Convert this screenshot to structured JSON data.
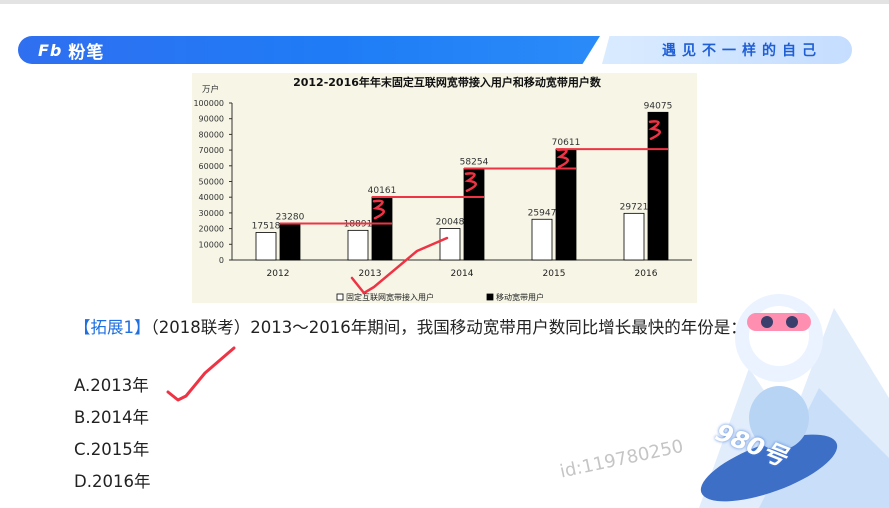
{
  "brand": {
    "logo_mark": "Fb",
    "logo_text": "粉笔"
  },
  "banner": {
    "slogan": "遇见不一样的自己"
  },
  "chart_data": {
    "type": "bar",
    "title": "2012-2016年年末固定互联网宽带接入用户和移动宽带用户数",
    "ylabel": "万户",
    "ylim": [
      0,
      100000
    ],
    "yticks": [
      0,
      10000,
      20000,
      30000,
      40000,
      50000,
      60000,
      70000,
      80000,
      90000,
      100000
    ],
    "categories": [
      "2012",
      "2013",
      "2014",
      "2015",
      "2016"
    ],
    "series": [
      {
        "name": "固定互联网宽带接入用户",
        "values": [
          17518,
          18891,
          20048,
          25947,
          29721
        ],
        "color": "#ffffff"
      },
      {
        "name": "移动宽带用户",
        "values": [
          23280,
          40161,
          58254,
          70611,
          94075
        ],
        "color": "#000000"
      }
    ],
    "value_labels": [
      [
        "17518",
        "18891",
        "20048",
        "25947",
        "29721"
      ],
      [
        "23280",
        "40161",
        "58254",
        "70611",
        "94075"
      ]
    ],
    "legend_position": "bottom"
  },
  "question": {
    "tag": "【拓展1】",
    "text": "（2018联考）2013～2016年期间，我国移动宽带用户数同比增长最快的年份是："
  },
  "options": [
    {
      "label": "A.2013年"
    },
    {
      "label": "B.2014年"
    },
    {
      "label": "C.2015年"
    },
    {
      "label": "D.2016年"
    }
  ],
  "watermark": "id:119780250",
  "mascot_tag": "980号",
  "colors": {
    "brand_blue": "#1f7cf6",
    "annotation_red": "#ee3344",
    "tag_blue": "#1e6fe0"
  }
}
